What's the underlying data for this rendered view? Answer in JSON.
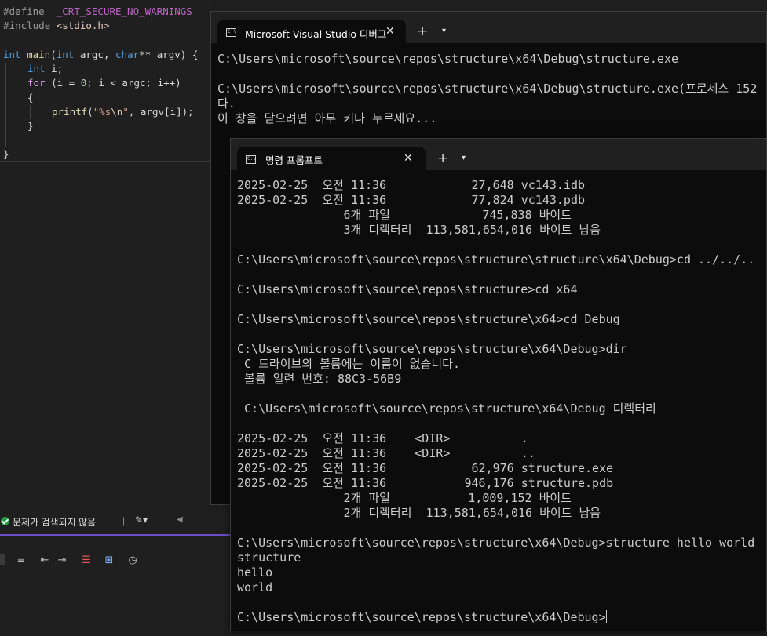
{
  "editor": {
    "lines": [
      [
        "#define ",
        " _CRT_SECURE_NO_WARNINGS"
      ],
      [
        "#include ",
        "<stdio.h>"
      ]
    ],
    "main_sig": {
      "int": "int",
      "main": "main",
      "p1": "(",
      "int2": "int",
      "argc": " argc, ",
      "char": "char",
      "argv": "** argv) {"
    },
    "decl": {
      "int": "int",
      "rest": " i;"
    },
    "for": {
      "for": "for",
      "a": " (i = ",
      "zero": "0",
      "b": "; i < argc; i++)"
    },
    "open": "{",
    "printf": {
      "fn": "printf",
      "a": "(",
      "s1": "\"%s",
      "esc": "\\n",
      "s2": "\"",
      ",": ", argv[i]);"
    },
    "close_inner": "}",
    "close_outer": "}"
  },
  "status": {
    "no_issues": "문제가 검색되지 않음",
    "sep": "|"
  },
  "vs_console": {
    "tab_title": "Microsoft Visual Studio 디버그",
    "tab_close": "✕",
    "new_tab": "+",
    "dropdown": "⌄",
    "lines": [
      "C:\\Users\\microsoft\\source\\repos\\structure\\x64\\Debug\\structure.exe",
      "",
      "C:\\Users\\microsoft\\source\\repos\\structure\\x64\\Debug\\structure.exe(프로세스 152",
      "다.",
      "이 창을 닫으려면 아무 키나 누르세요..."
    ]
  },
  "cmd": {
    "tab_title": "명령 프롬프트",
    "tab_close": "✕",
    "new_tab": "+",
    "dropdown": "⌄",
    "lines": [
      "2025-02-25  오전 11:36            27,648 vc143.idb",
      "2025-02-25  오전 11:36            77,824 vc143.pdb",
      "               6개 파일             745,838 바이트",
      "               3개 디렉터리  113,581,654,016 바이트 남음",
      "",
      "C:\\Users\\microsoft\\source\\repos\\structure\\structure\\x64\\Debug>cd ../../..",
      "",
      "C:\\Users\\microsoft\\source\\repos\\structure>cd x64",
      "",
      "C:\\Users\\microsoft\\source\\repos\\structure\\x64>cd Debug",
      "",
      "C:\\Users\\microsoft\\source\\repos\\structure\\x64\\Debug>dir",
      " C 드라이브의 볼륨에는 이름이 없습니다.",
      " 볼륨 일련 번호: 88C3-56B9",
      "",
      " C:\\Users\\microsoft\\source\\repos\\structure\\x64\\Debug 디렉터리",
      "",
      "2025-02-25  오전 11:36    <DIR>          .",
      "2025-02-25  오전 11:36    <DIR>          ..",
      "2025-02-25  오전 11:36            62,976 structure.exe",
      "2025-02-25  오전 11:36           946,176 structure.pdb",
      "               2개 파일           1,009,152 바이트",
      "               2개 디렉터리  113,581,654,016 바이트 남음",
      "",
      "C:\\Users\\microsoft\\source\\repos\\structure\\x64\\Debug>structure hello world",
      "structure",
      "hello",
      "world",
      "",
      "C:\\Users\\microsoft\\source\\repos\\structure\\x64\\Debug>"
    ]
  },
  "colors": {
    "terminal_bg": "#0c0c0c",
    "terminal_fg": "#cccccc",
    "titlebar": "#202020",
    "accent": "#6e4fc9",
    "ok_green": "#1e9b3c"
  }
}
